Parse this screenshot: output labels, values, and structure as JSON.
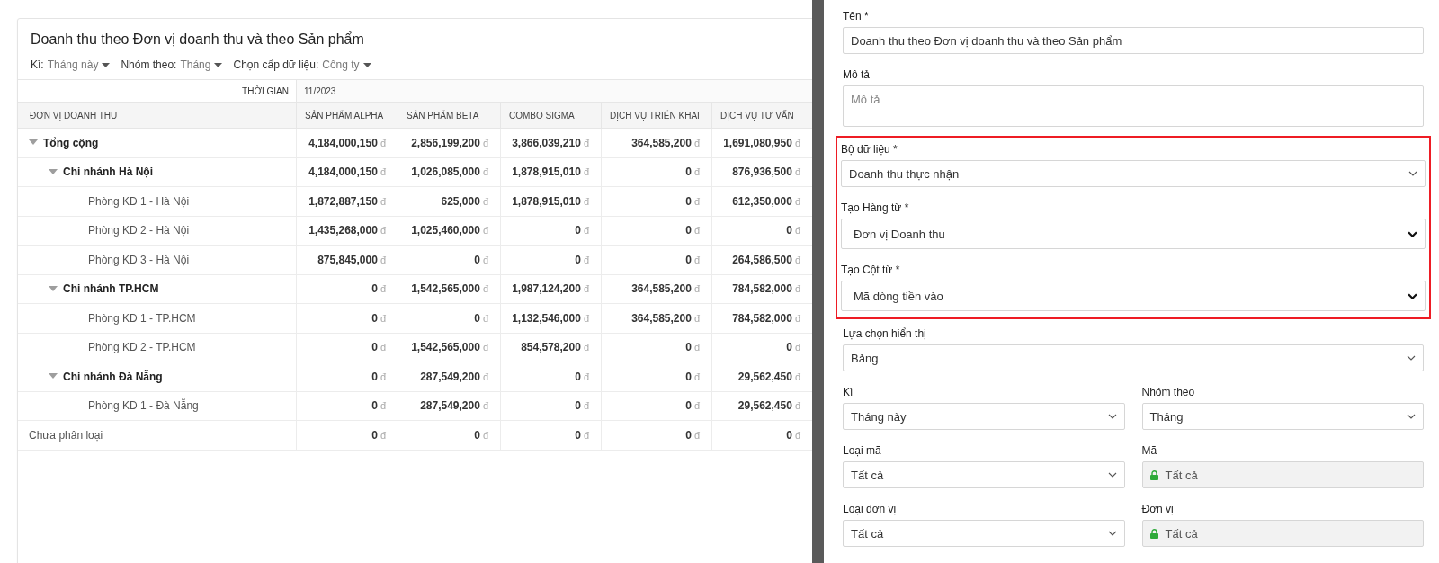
{
  "report": {
    "title": "Doanh thu theo Đơn vị doanh thu và theo Sản phẩm",
    "filters": [
      {
        "label": "Kì:",
        "value": "Tháng này"
      },
      {
        "label": "Nhóm theo:",
        "value": "Tháng"
      },
      {
        "label": "Chọn cấp dữ liệu:",
        "value": "Công ty"
      }
    ],
    "table": {
      "time_label": "THỜI GIAN",
      "period": "11/2023",
      "row_header": "ĐƠN VỊ DOANH THU",
      "columns": [
        "SẢN PHẨM ALPHA",
        "SẢN PHẨM BETA",
        "COMBO SIGMA",
        "DỊCH VỤ TRIỂN KHAI",
        "DỊCH VỤ TƯ VẤN"
      ],
      "rows": [
        {
          "name": "Tổng cộng",
          "expanded": true,
          "cells": [
            [
              "4,184,000,150",
              "đ"
            ],
            [
              "2,856,199,200",
              "đ"
            ],
            [
              "3,866,039,210",
              "đ"
            ],
            [
              "364,585,200",
              "đ"
            ],
            [
              "1,691,080,950",
              "đ"
            ]
          ],
          "children": [
            {
              "name": "Chi nhánh Hà Nội",
              "expanded": true,
              "cells": [
                [
                  "4,184,000,150",
                  "đ"
                ],
                [
                  "1,026,085,000",
                  "đ"
                ],
                [
                  "1,878,915,010",
                  "đ"
                ],
                [
                  "0",
                  "đ"
                ],
                [
                  "876,936,500",
                  "đ"
                ]
              ],
              "children": [
                {
                  "name": "Phòng KD 1 - Hà Nội",
                  "cells": [
                    [
                      "1,872,887,150",
                      "đ"
                    ],
                    [
                      "625,000",
                      "đ"
                    ],
                    [
                      "1,878,915,010",
                      "đ"
                    ],
                    [
                      "0",
                      "đ"
                    ],
                    [
                      "612,350,000",
                      "đ"
                    ]
                  ]
                },
                {
                  "name": "Phòng KD 2 - Hà Nội",
                  "cells": [
                    [
                      "1,435,268,000",
                      "đ"
                    ],
                    [
                      "1,025,460,000",
                      "đ"
                    ],
                    [
                      "0",
                      "đ"
                    ],
                    [
                      "0",
                      "đ"
                    ],
                    [
                      "0",
                      "đ"
                    ]
                  ]
                },
                {
                  "name": "Phòng KD 3 - Hà Nội",
                  "cells": [
                    [
                      "875,845,000",
                      "đ"
                    ],
                    [
                      "0",
                      "đ"
                    ],
                    [
                      "0",
                      "đ"
                    ],
                    [
                      "0",
                      "đ"
                    ],
                    [
                      "264,586,500",
                      "đ"
                    ]
                  ]
                }
              ]
            },
            {
              "name": "Chi nhánh TP.HCM",
              "expanded": true,
              "cells": [
                [
                  "0",
                  "đ"
                ],
                [
                  "1,542,565,000",
                  "đ"
                ],
                [
                  "1,987,124,200",
                  "đ"
                ],
                [
                  "364,585,200",
                  "đ"
                ],
                [
                  "784,582,000",
                  "đ"
                ]
              ],
              "children": [
                {
                  "name": "Phòng KD 1 - TP.HCM",
                  "cells": [
                    [
                      "0",
                      "đ"
                    ],
                    [
                      "0",
                      "đ"
                    ],
                    [
                      "1,132,546,000",
                      "đ"
                    ],
                    [
                      "364,585,200",
                      "đ"
                    ],
                    [
                      "784,582,000",
                      "đ"
                    ]
                  ]
                },
                {
                  "name": "Phòng KD 2 - TP.HCM",
                  "cells": [
                    [
                      "0",
                      "đ"
                    ],
                    [
                      "1,542,565,000",
                      "đ"
                    ],
                    [
                      "854,578,200",
                      "đ"
                    ],
                    [
                      "0",
                      "đ"
                    ],
                    [
                      "0",
                      "đ"
                    ]
                  ]
                }
              ]
            },
            {
              "name": "Chi nhánh Đà Nẵng",
              "expanded": true,
              "cells": [
                [
                  "0",
                  "đ"
                ],
                [
                  "287,549,200",
                  "đ"
                ],
                [
                  "0",
                  "đ"
                ],
                [
                  "0",
                  "đ"
                ],
                [
                  "29,562,450",
                  "đ"
                ]
              ],
              "children": [
                {
                  "name": "Phòng KD 1 - Đà Nẵng",
                  "cells": [
                    [
                      "0",
                      "đ"
                    ],
                    [
                      "287,549,200",
                      "đ"
                    ],
                    [
                      "0",
                      "đ"
                    ],
                    [
                      "0",
                      "đ"
                    ],
                    [
                      "29,562,450",
                      "đ"
                    ]
                  ]
                }
              ]
            }
          ]
        },
        {
          "name": "Chưa phân loại",
          "cells": [
            [
              "0",
              "đ"
            ],
            [
              "0",
              "đ"
            ],
            [
              "0",
              "đ"
            ],
            [
              "0",
              "đ"
            ],
            [
              "0",
              "đ"
            ]
          ]
        }
      ]
    }
  },
  "form": {
    "groups": [
      {
        "highlighted": false,
        "rows": [
          [
            {
              "label": "Tên *",
              "kind": "text",
              "value": "Doanh thu theo Đơn vị doanh thu và theo Sản phẩm"
            }
          ],
          [
            {
              "label": "Mô tả",
              "kind": "textarea",
              "placeholder": "Mô tả"
            }
          ]
        ]
      },
      {
        "highlighted": true,
        "rows": [
          [
            {
              "label": "Bộ dữ liệu *",
              "kind": "select",
              "value": "Doanh thu thực nhận"
            }
          ],
          [
            {
              "label": "Tạo Hàng từ *",
              "kind": "native_select",
              "value": "Đơn vị Doanh thu"
            }
          ],
          [
            {
              "label": "Tạo Cột từ *",
              "kind": "native_select",
              "value": "Mã dòng tiền vào"
            }
          ]
        ]
      },
      {
        "highlighted": false,
        "rows": [
          [
            {
              "label": "Lựa chọn hiển thị",
              "kind": "select",
              "value": "Bảng"
            }
          ],
          [
            {
              "label": "Kì",
              "kind": "select",
              "value": "Tháng này"
            },
            {
              "label": "Nhóm theo",
              "kind": "select",
              "value": "Tháng"
            }
          ],
          [
            {
              "label": "Loại mã",
              "kind": "select",
              "value": "Tất cả"
            },
            {
              "label": "Mã",
              "kind": "locked",
              "value": "Tất cả"
            }
          ],
          [
            {
              "label": "Loại đơn vị",
              "kind": "select",
              "value": "Tất cả"
            },
            {
              "label": "Đơn vị",
              "kind": "locked",
              "value": "Tất cả"
            }
          ]
        ]
      }
    ]
  }
}
